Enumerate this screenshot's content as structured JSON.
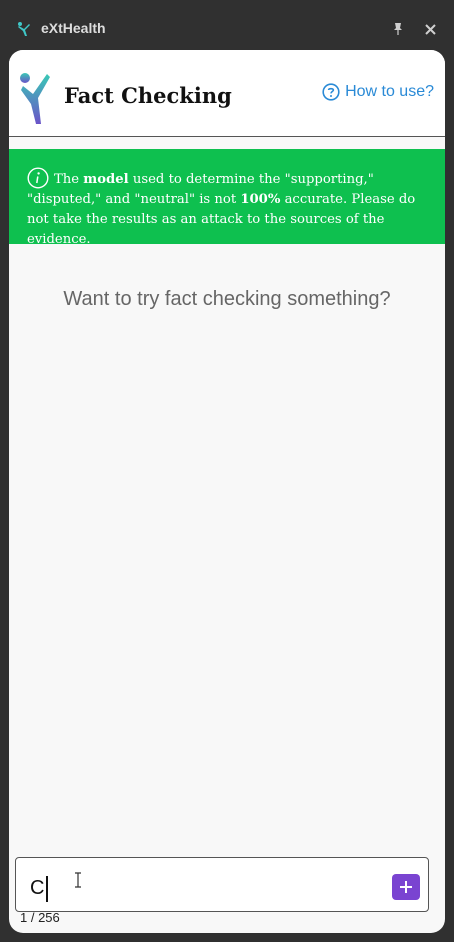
{
  "window": {
    "title": "eXtHealth"
  },
  "header": {
    "title": "Fact Checking",
    "help_link": "How to use?"
  },
  "banner": {
    "part1": "The ",
    "bold1": "model",
    "part2": " used to determine the \"supporting,\" \"disputed,\" and \"neutral\" is not ",
    "bold2": "100%",
    "part3": " accurate. Please do not take the results as an attack to the sources of the evidence."
  },
  "main": {
    "prompt": "Want to try fact checking something?"
  },
  "input": {
    "value": "C",
    "counter": "1 / 256"
  },
  "colors": {
    "banner": "#0ec04f",
    "accent": "#2a8ad6",
    "send": "#7a44d1"
  }
}
